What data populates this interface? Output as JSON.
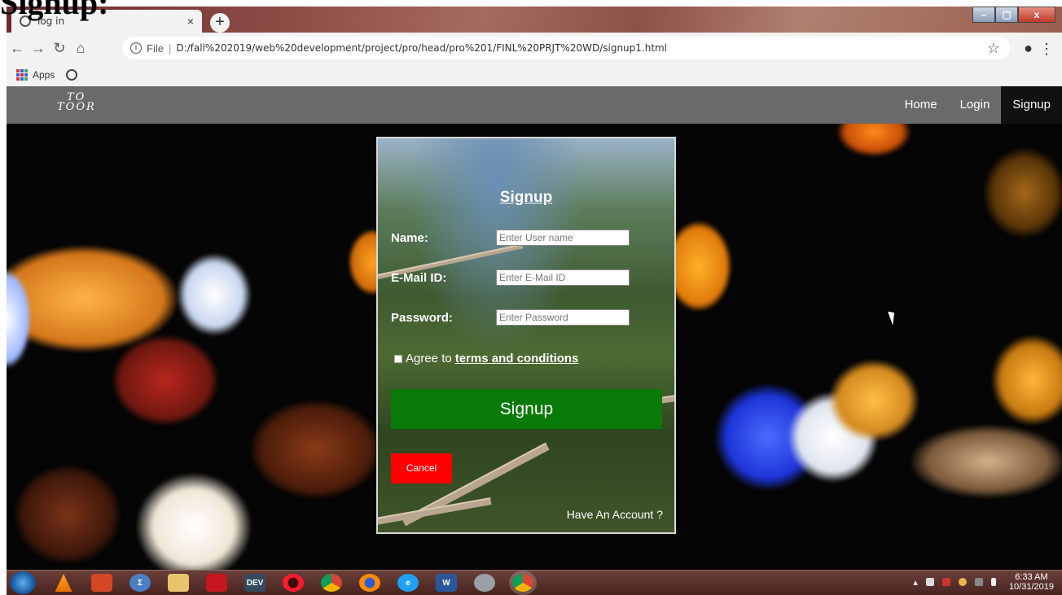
{
  "doc_heading": "Signup:",
  "browser": {
    "tab_title": "log in",
    "tab_close": "×",
    "new_tab": "+",
    "url_label": "File",
    "url_sep": "|",
    "url": "D:/fall%202019/web%20development/project/pro/head/pro%201/FINL%20PRJT%20WD/signup1.html",
    "bookmarks": {
      "apps_label": "Apps"
    },
    "window_buttons": {
      "minimize": "–",
      "maximize": "▢",
      "close": "x"
    }
  },
  "site": {
    "logo_line1": "TO",
    "logo_line2": "TOOR",
    "nav": [
      {
        "label": "Home"
      },
      {
        "label": "Login"
      },
      {
        "label": "Signup"
      }
    ]
  },
  "form": {
    "title": "Signup",
    "name_label": "Name:",
    "name_placeholder": "Enter User name",
    "email_label": "E-Mail ID:",
    "email_placeholder": "Enter E-Mail ID",
    "password_label": "Password:",
    "password_placeholder": "Enter Password",
    "agree_text": "Agree to",
    "terms_text": "terms and conditions",
    "signup_button": "Signup",
    "cancel_button": "Cancel",
    "have_account": "Have An Account ?"
  },
  "taskbar": {
    "time": "6:33 AM",
    "date": "10/31/2019",
    "dev_label": "DEV"
  },
  "colors": {
    "nav_bg": "#6a6a6a",
    "nav_active": "#111111",
    "signup_green": "#087a08",
    "cancel_red": "#ff0000"
  }
}
